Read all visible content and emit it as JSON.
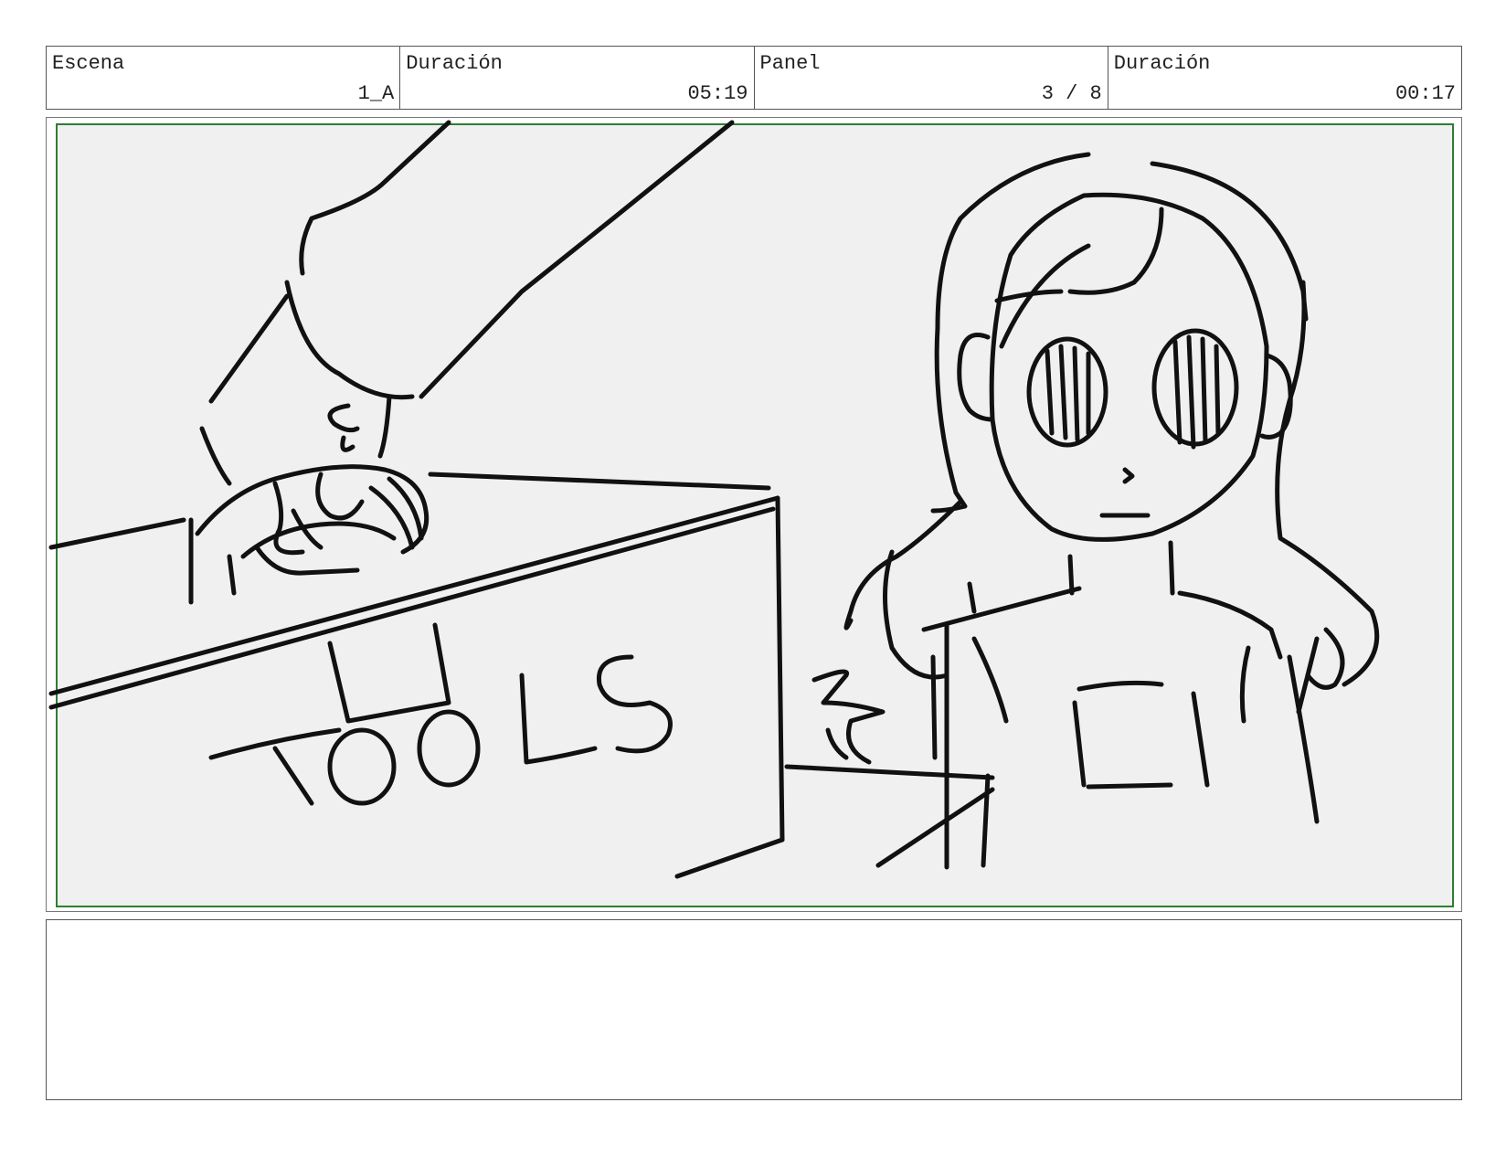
{
  "header": {
    "scene": {
      "label": "Escena",
      "value": "1_A"
    },
    "scene_duration": {
      "label": "Duración",
      "value": "05:19"
    },
    "panel": {
      "label": "Panel",
      "value": "3 / 8"
    },
    "panel_duration": {
      "label": "Duración",
      "value": "00:17"
    }
  },
  "panel_image": {
    "box_text": "TOOLS",
    "safe_area_color": "#2e7d32",
    "background_color": "#f0f0f0",
    "ink_color": "#111111"
  },
  "notes": {
    "text": ""
  }
}
